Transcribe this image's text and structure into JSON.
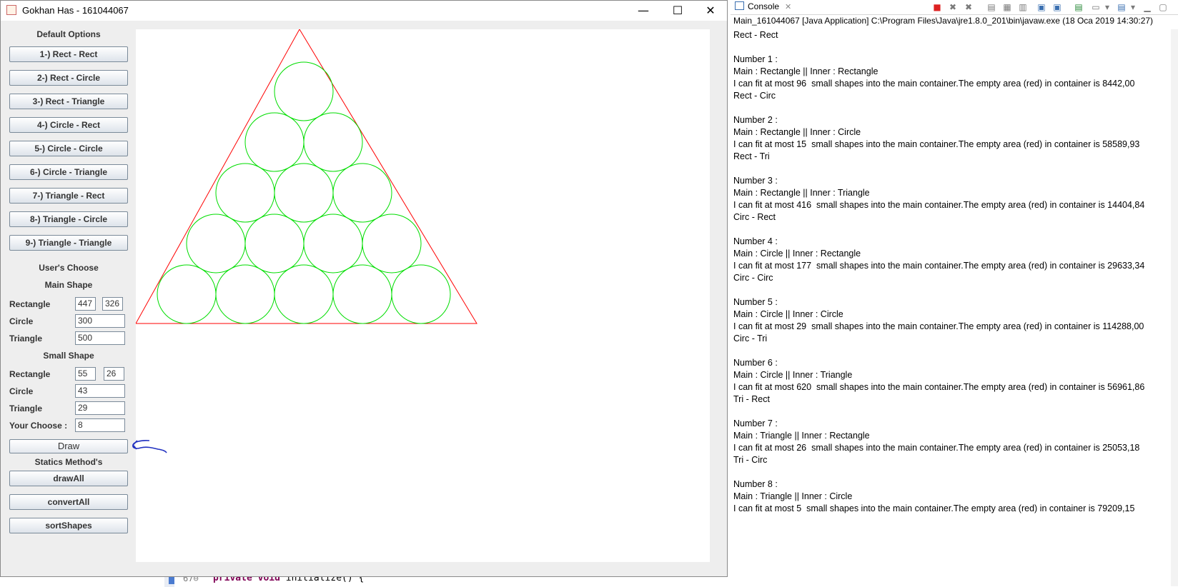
{
  "window": {
    "title": "Gokhan Has - 161044067",
    "minimize": "—",
    "maximize": "☐",
    "close": "✕"
  },
  "default_options": {
    "label": "Default Options",
    "buttons": [
      "1-) Rect - Rect",
      "2-) Rect - Circle",
      "3-) Rect - Triangle",
      "4-) Circle - Rect",
      "5-) Circle - Circle",
      "6-) Circle - Triangle",
      "7-) Triangle - Rect",
      "8-) Triangle - Circle",
      "9-) Triangle - Triangle"
    ]
  },
  "users_choose": {
    "label": "User's Choose",
    "main_shape": {
      "label": "Main Shape",
      "rectangle_label": "Rectangle",
      "rectangle_w": "447",
      "rectangle_h": "326",
      "circle_label": "Circle",
      "circle": "300",
      "triangle_label": "Triangle",
      "triangle": "500"
    },
    "small_shape": {
      "label": "Small Shape",
      "rectangle_label": "Rectangle",
      "rectangle_w": "55",
      "rectangle_h": "26",
      "circle_label": "Circle",
      "circle": "43",
      "triangle_label": "Triangle",
      "triangle": "29"
    },
    "your_choose_label": "Your Choose :",
    "your_choose": "8",
    "draw_label": "Draw"
  },
  "statics": {
    "label": "Statics Method's",
    "buttons": [
      "drawAll",
      "convertAll",
      "sortShapes"
    ]
  },
  "drawing": {
    "container": "triangle",
    "inner": "circle",
    "rows_of_circles": [
      1,
      2,
      3,
      4,
      5
    ],
    "container_color": "#ff0000",
    "inner_color": "#00dd00"
  },
  "background_editor": {
    "line_number": "67⊖",
    "code_keyword": "private void",
    "code_rest": " initialize() {"
  },
  "console": {
    "tab": "Console",
    "path": "Main_161044067 [Java Application] C:\\Program Files\\Java\\jre1.8.0_201\\bin\\javaw.exe (18 Oca 2019 14:30:27)",
    "lines": [
      "Rect - Rect",
      "",
      "Number 1 :",
      "Main : Rectangle || Inner : Rectangle",
      "I can fit at most 96  small shapes into the main container.The empty area (red) in container is 8442,00",
      "Rect - Circ",
      "",
      "Number 2 :",
      "Main : Rectangle || Inner : Circle",
      "I can fit at most 15  small shapes into the main container.The empty area (red) in container is 58589,93",
      "Rect - Tri",
      "",
      "Number 3 :",
      "Main : Rectangle || Inner : Triangle",
      "I can fit at most 416  small shapes into the main container.The empty area (red) in container is 14404,84",
      "Circ - Rect",
      "",
      "Number 4 :",
      "Main : Circle || Inner : Rectangle",
      "I can fit at most 177  small shapes into the main container.The empty area (red) in container is 29633,34",
      "Circ - Circ",
      "",
      "Number 5 :",
      "Main : Circle || Inner : Circle",
      "I can fit at most 29  small shapes into the main container.The empty area (red) in container is 114288,00",
      "Circ - Tri",
      "",
      "Number 6 :",
      "Main : Circle || Inner : Triangle",
      "I can fit at most 620  small shapes into the main container.The empty area (red) in container is 56961,86",
      "Tri - Rect",
      "",
      "Number 7 :",
      "Main : Triangle || Inner : Rectangle",
      "I can fit at most 26  small shapes into the main container.The empty area (red) in container is 25053,18",
      "Tri - Circ",
      "",
      "Number 8 :",
      "Main : Triangle || Inner : Circle",
      "I can fit at most 5  small shapes into the main container.The empty area (red) in container is 79209,15"
    ]
  }
}
